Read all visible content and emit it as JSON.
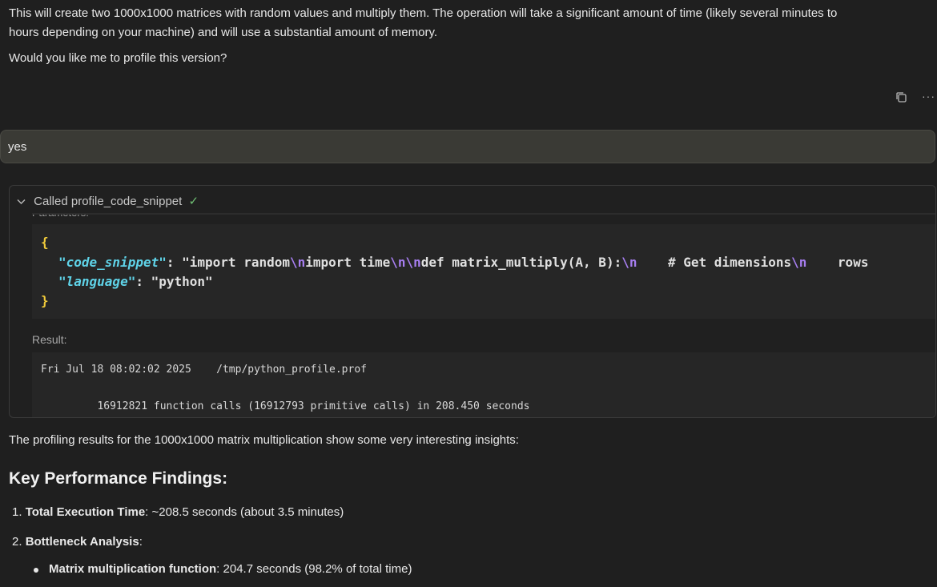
{
  "intro": {
    "line1": "This will create two 1000x1000 matrices with random values and multiply them. The operation will take a significant amount of time (likely several minutes to",
    "line2": "hours depending on your machine) and will use a substantial amount of memory.",
    "question": "Would you like me to profile this version?"
  },
  "toolbar": {
    "copy_icon": "copy-icon",
    "more_icon": "more-icon",
    "more_glyph": "···"
  },
  "user_message": {
    "text": "yes"
  },
  "tool_call": {
    "title": "Called profile_code_snippet",
    "check": "✓",
    "parameters_label": "Parameters:",
    "code": {
      "open_brace": "{",
      "close_brace": "}",
      "line1_key": "\"code_snippet\"",
      "line1_seg1": ": \"import random",
      "line1_esc1": "\\n",
      "line1_seg2": "import time",
      "line1_esc2": "\\n\\n",
      "line1_seg3": "def matrix_multiply(A, B):",
      "line1_esc3": "\\n",
      "line1_seg4": "    # Get dimensions",
      "line1_esc4": "\\n",
      "line1_seg5": "    rows",
      "line2_key": "\"language\"",
      "line2_rest": ": \"python\""
    },
    "result_label": "Result:",
    "result_lines": [
      "Fri Jul 18 08:02:02 2025    /tmp/python_profile.prof",
      "         16912821 function calls (16912793 primitive calls) in 208.450 seconds"
    ]
  },
  "response": {
    "summary": "The profiling results for the 1000x1000 matrix multiplication show some very interesting insights:",
    "heading": "Key Performance Findings:",
    "items": [
      {
        "number": "1.",
        "bold": "Total Execution Time",
        "rest": ": ~208.5 seconds (about 3.5 minutes)"
      },
      {
        "number": "2.",
        "bold": "Bottleneck Analysis",
        "rest": ":"
      }
    ],
    "subitems": [
      {
        "bold": "Matrix multiplication function",
        "rest": ": 204.7 seconds (98.2% of total time)"
      }
    ]
  }
}
